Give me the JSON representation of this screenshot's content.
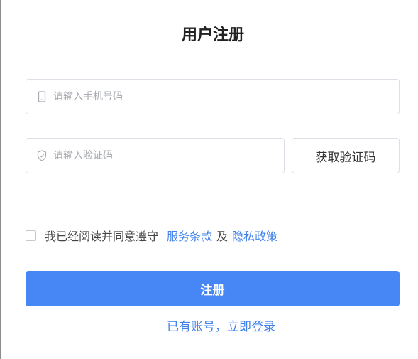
{
  "form": {
    "title": "用户注册",
    "phone_placeholder": "请输入手机号码",
    "code_placeholder": "请输入验证码",
    "get_code_label": "获取验证码",
    "agree_text": "我已经阅读并同意遵守",
    "terms_link": "服务条款",
    "and_text": "及",
    "privacy_link": "隐私政策",
    "submit_label": "注册",
    "login_link": "已有账号，立即登录"
  },
  "icons": {
    "phone": "mobile-phone-icon",
    "code": "shield-icon"
  },
  "colors": {
    "primary": "#4787f5",
    "link": "#3f80ea",
    "border": "#dcdfe6",
    "placeholder": "#a8abb2"
  }
}
